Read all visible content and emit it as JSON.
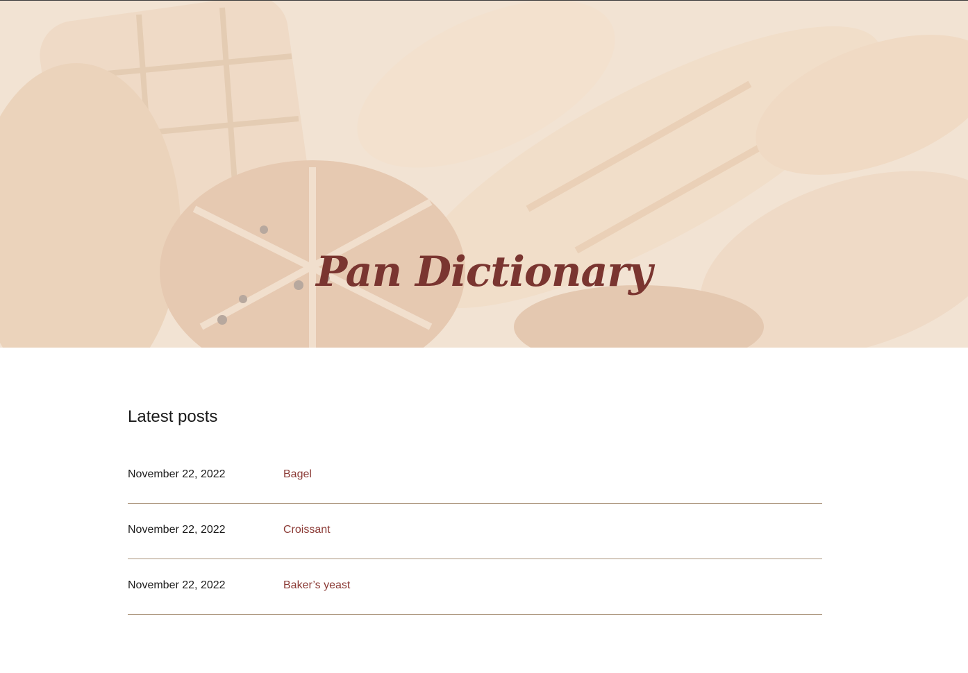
{
  "site": {
    "title": "Pan Dictionary"
  },
  "hero": {
    "image": "bread-loaves-photo",
    "tint": "#f1e1d0"
  },
  "latest": {
    "heading": "Latest posts",
    "posts": [
      {
        "date": "November 22, 2022",
        "title": "Bagel"
      },
      {
        "date": "November 22, 2022",
        "title": "Croissant"
      },
      {
        "date": "November 22, 2022",
        "title": "Baker’s yeast"
      }
    ]
  },
  "colors": {
    "accent": "#8b3a35",
    "divider": "#a89278",
    "text": "#1a1a1a"
  }
}
